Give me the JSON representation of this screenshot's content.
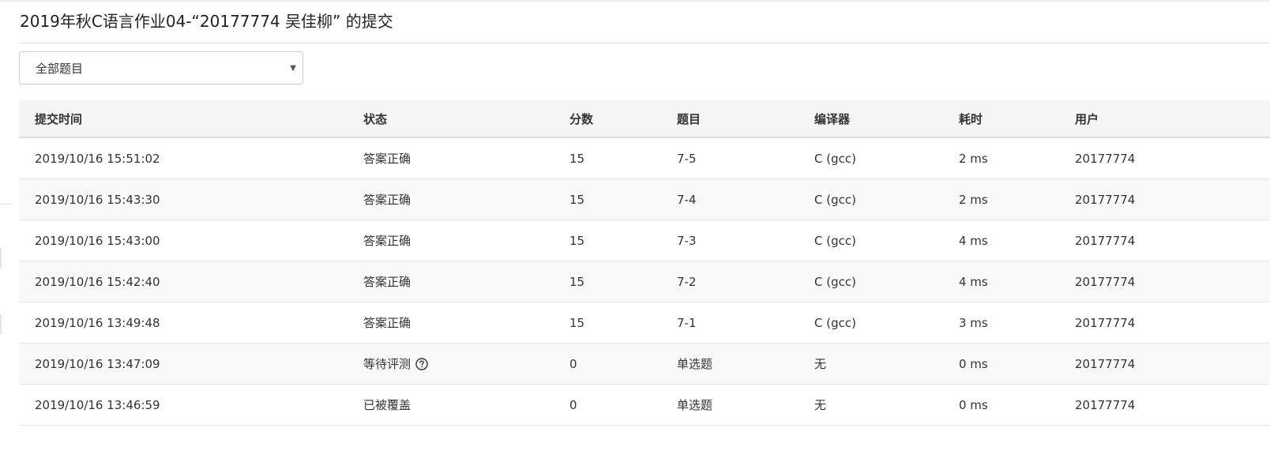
{
  "page": {
    "title": "2019年秋C语言作业04-“20177774 吴佳柳” 的提交"
  },
  "filter": {
    "selected": "全部题目"
  },
  "table": {
    "headers": [
      "提交时间",
      "状态",
      "分数",
      "题目",
      "编译器",
      "耗时",
      "用户"
    ],
    "rows": [
      {
        "time": "2019/10/16 15:51:02",
        "status": "答案正确",
        "score": "15",
        "problem": "7-5",
        "compiler": "C (gcc)",
        "elapsed": "2 ms",
        "user": "20177774"
      },
      {
        "time": "2019/10/16 15:43:30",
        "status": "答案正确",
        "score": "15",
        "problem": "7-4",
        "compiler": "C (gcc)",
        "elapsed": "2 ms",
        "user": "20177774"
      },
      {
        "time": "2019/10/16 15:43:00",
        "status": "答案正确",
        "score": "15",
        "problem": "7-3",
        "compiler": "C (gcc)",
        "elapsed": "4 ms",
        "user": "20177774"
      },
      {
        "time": "2019/10/16 15:42:40",
        "status": "答案正确",
        "score": "15",
        "problem": "7-2",
        "compiler": "C (gcc)",
        "elapsed": "4 ms",
        "user": "20177774"
      },
      {
        "time": "2019/10/16 13:49:48",
        "status": "答案正确",
        "score": "15",
        "problem": "7-1",
        "compiler": "C (gcc)",
        "elapsed": "3 ms",
        "user": "20177774"
      },
      {
        "time": "2019/10/16 13:47:09",
        "status": "等待评测",
        "score": "0",
        "problem": "单选题",
        "compiler": "无",
        "elapsed": "0 ms",
        "user": "20177774"
      },
      {
        "time": "2019/10/16 13:46:59",
        "status": "已被覆盖",
        "score": "0",
        "problem": "单选题",
        "compiler": "无",
        "elapsed": "0 ms",
        "user": "20177774"
      }
    ]
  },
  "colors": {
    "accepted": "#e74c3c",
    "link": "#1f5a9c",
    "header_bg": "#f5f5f5"
  },
  "icons": {
    "filter_caret": "chevron-down-icon",
    "pending_help": "help-circle-icon"
  }
}
